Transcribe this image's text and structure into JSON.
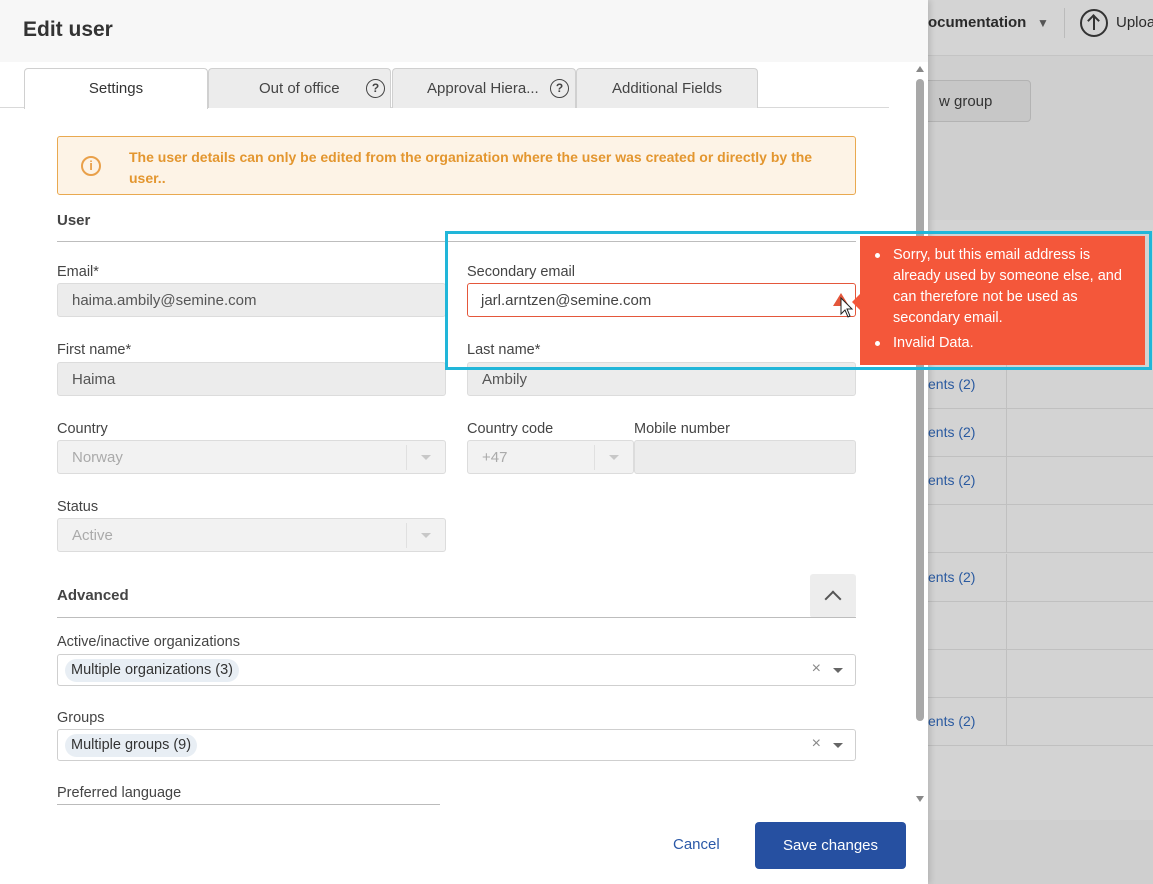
{
  "background": {
    "documentation_label": "ocumentation",
    "upload_label": "Uploa",
    "new_group_label": "w group",
    "row_links": [
      "ents (2)",
      "ents (2)",
      "ents (2)",
      "",
      "ents (2)",
      "",
      "",
      "ents (2)"
    ]
  },
  "modal": {
    "title": "Edit user",
    "tabs": [
      {
        "label": "Settings",
        "active": true
      },
      {
        "label": "Out of office",
        "help": true
      },
      {
        "label": "Approval Hiera...",
        "help": true
      },
      {
        "label": "Additional Fields"
      }
    ],
    "help_glyph": "?",
    "notice": {
      "icon": "info-icon",
      "icon_glyph": "i",
      "text": "The user details can only be edited from the organization where the user was created or directly by the user.."
    },
    "user_section": {
      "title": "User",
      "email": {
        "label": "Email*",
        "value": "haima.ambily@semine.com"
      },
      "secondary_email": {
        "label": "Secondary email",
        "value": "jarl.arntzen@semine.com",
        "error": true
      },
      "first_name": {
        "label": "First name*",
        "value": "Haima"
      },
      "last_name": {
        "label": "Last name*",
        "value": "Ambily"
      },
      "country": {
        "label": "Country",
        "value": "Norway"
      },
      "country_code": {
        "label": "Country code",
        "value": "+47"
      },
      "mobile": {
        "label": "Mobile number",
        "value": ""
      },
      "status": {
        "label": "Status",
        "value": "Active"
      }
    },
    "advanced_section": {
      "title": "Advanced",
      "organizations": {
        "label": "Active/inactive organizations",
        "chip": "Multiple organizations (3)"
      },
      "groups": {
        "label": "Groups",
        "chip": "Multiple groups (9)"
      },
      "language": {
        "label": "Preferred language"
      },
      "clear_glyph": "×"
    },
    "footer": {
      "cancel_label": "Cancel",
      "save_label": "Save changes"
    }
  },
  "error_popover": {
    "messages": [
      "Sorry, but this email address is already used by someone else, and can therefore not be used as secondary email.",
      "Invalid Data."
    ]
  },
  "colors": {
    "primary": "#2650a1",
    "error": "#f4573a",
    "warning": "#e3962f",
    "highlight": "#21b6d9"
  }
}
